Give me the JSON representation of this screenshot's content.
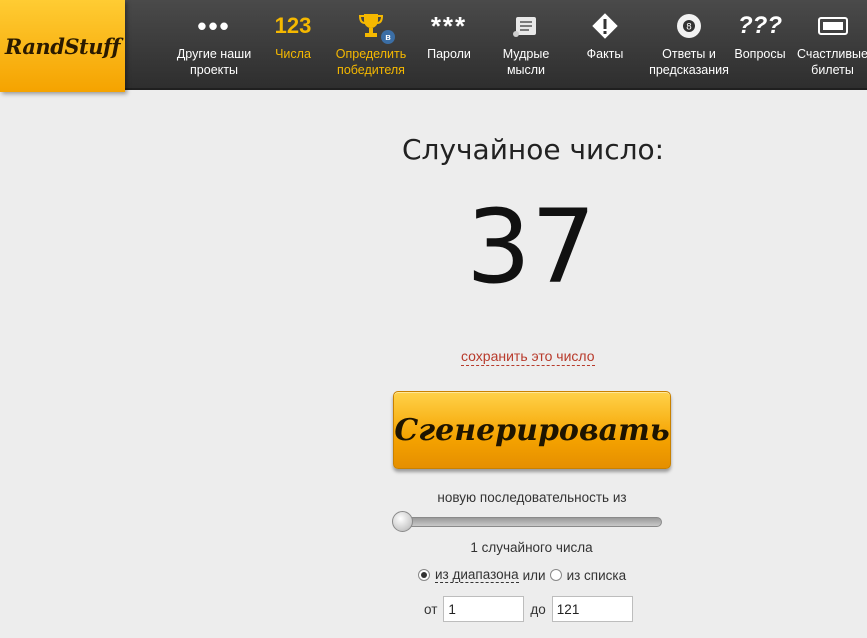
{
  "logo": {
    "text": "RandStuff"
  },
  "nav": [
    {
      "icon": "dots-icon",
      "glyph": "•••",
      "label": "Другие наши\nпроекты",
      "active": false
    },
    {
      "icon": "numbers-icon",
      "glyph": "123",
      "label": "Числа",
      "active": false
    },
    {
      "icon": "trophy-icon",
      "glyph": "",
      "label": "Определить\nпобедителя",
      "active": true,
      "badge": "в"
    },
    {
      "icon": "asterisks-icon",
      "glyph": "***",
      "label": "Пароли",
      "active": false
    },
    {
      "icon": "scroll-icon",
      "glyph": "",
      "label": "Мудрые\nмысли",
      "active": false
    },
    {
      "icon": "warning-diamond-icon",
      "glyph": "!",
      "label": "Факты",
      "active": false
    },
    {
      "icon": "eight-ball-icon",
      "glyph": "8",
      "label": "Ответы и\nпредсказания",
      "active": false
    },
    {
      "icon": "question-marks-icon",
      "glyph": "???",
      "label": "Вопросы",
      "active": false
    },
    {
      "icon": "ticket-icon",
      "glyph": "",
      "label": "Счастливые\nбилеты",
      "active": false
    }
  ],
  "main": {
    "title": "Случайное число:",
    "result": "37",
    "save_link": "сохранить это число",
    "generate_button": "Сгенерировать",
    "sequence_label": "новую последовательность из",
    "slider_value": 0,
    "count_label": "1 случайного числа",
    "mode": {
      "range_label": "из диапазона",
      "or": "или",
      "list_label": "из списка",
      "selected": "range"
    },
    "range": {
      "from_label": "от",
      "from_value": "1",
      "to_label": "до",
      "to_value": "121"
    }
  },
  "colors": {
    "accent": "#f5b800",
    "header_bg": "#3a3a3a",
    "link": "#b83a2b"
  }
}
